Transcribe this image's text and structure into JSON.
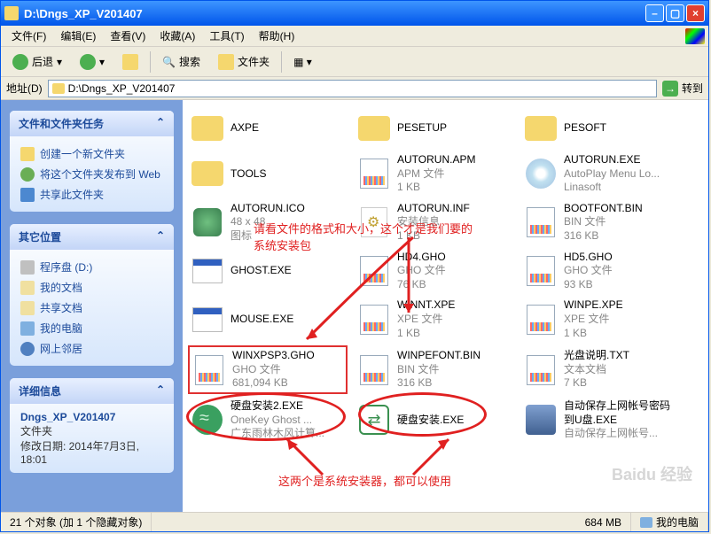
{
  "window": {
    "title": "D:\\Dngs_XP_V201407"
  },
  "menu": [
    "文件(F)",
    "编辑(E)",
    "查看(V)",
    "收藏(A)",
    "工具(T)",
    "帮助(H)"
  ],
  "toolbar": {
    "back": "后退",
    "search": "搜索",
    "folders": "文件夹"
  },
  "addrbar": {
    "label": "地址(D)",
    "path": "D:\\Dngs_XP_V201407",
    "go": "转到"
  },
  "sidebar": {
    "tasks_title": "文件和文件夹任务",
    "tasks": [
      "创建一个新文件夹",
      "将这个文件夹发布到 Web",
      "共享此文件夹"
    ],
    "other_title": "其它位置",
    "others": [
      "程序盘 (D:)",
      "我的文档",
      "共享文档",
      "我的电脑",
      "网上邻居"
    ],
    "details_title": "详细信息",
    "details": {
      "name": "Dngs_XP_V201407",
      "type": "文件夹",
      "modified": "修改日期: 2014年7月3日, 18:01"
    }
  },
  "files": [
    {
      "name": "AXPE",
      "type": "folder"
    },
    {
      "name": "PESETUP",
      "type": "folder"
    },
    {
      "name": "PESOFT",
      "type": "folder"
    },
    {
      "name": "TOOLS",
      "type": "folder"
    },
    {
      "name": "AUTORUN.APM",
      "sub1": "APM 文件",
      "sub2": "1 KB",
      "type": "bin"
    },
    {
      "name": "AUTORUN.EXE",
      "sub1": "AutoPlay Menu Lo...",
      "sub2": "Linasoft",
      "type": "cd"
    },
    {
      "name": "AUTORUN.ICO",
      "sub1": "48 x 48",
      "sub2": "图标",
      "type": "ico"
    },
    {
      "name": "AUTORUN.INF",
      "sub1": "安装信息",
      "sub2": "1 KB",
      "type": "inf"
    },
    {
      "name": "BOOTFONT.BIN",
      "sub1": "BIN 文件",
      "sub2": "316 KB",
      "type": "bin"
    },
    {
      "name": "GHOST.EXE",
      "type": "exe"
    },
    {
      "name": "HD4.GHO",
      "sub1": "GHO 文件",
      "sub2": "76 KB",
      "type": "bin"
    },
    {
      "name": "HD5.GHO",
      "sub1": "GHO 文件",
      "sub2": "93 KB",
      "type": "bin"
    },
    {
      "name": "MOUSE.EXE",
      "type": "exe"
    },
    {
      "name": "WINNT.XPE",
      "sub1": "XPE 文件",
      "sub2": "1 KB",
      "type": "bin"
    },
    {
      "name": "WINPE.XPE",
      "sub1": "XPE 文件",
      "sub2": "1 KB",
      "type": "bin"
    },
    {
      "name": "WINXPSP3.GHO",
      "sub1": "GHO 文件",
      "sub2": "681,094 KB",
      "type": "bin",
      "selected": true
    },
    {
      "name": "WINPEFONT.BIN",
      "sub1": "BIN 文件",
      "sub2": "316 KB",
      "type": "bin"
    },
    {
      "name": "光盘说明.TXT",
      "sub1": "文本文档",
      "sub2": "7 KB",
      "type": "bin"
    },
    {
      "name": "硬盘安装2.EXE",
      "sub1": "OneKey Ghost ...",
      "sub2": "广东雨林木风计算...",
      "type": "green"
    },
    {
      "name": "硬盘安装.EXE",
      "type": "sync"
    },
    {
      "name": "自动保存上网帐号密码到U盘.EXE",
      "sub1": "自动保存上网帐号...",
      "type": "net"
    }
  ],
  "annotations": {
    "top": "请看文件的格式和大小，这个才是我们要的\n系统安装包",
    "bottom": "这两个是系统安装器，都可以使用"
  },
  "statusbar": {
    "objects": "21 个对象 (加 1 个隐藏对象)",
    "size": "684 MB",
    "location": "我的电脑"
  },
  "watermark": "Baidu 经验"
}
